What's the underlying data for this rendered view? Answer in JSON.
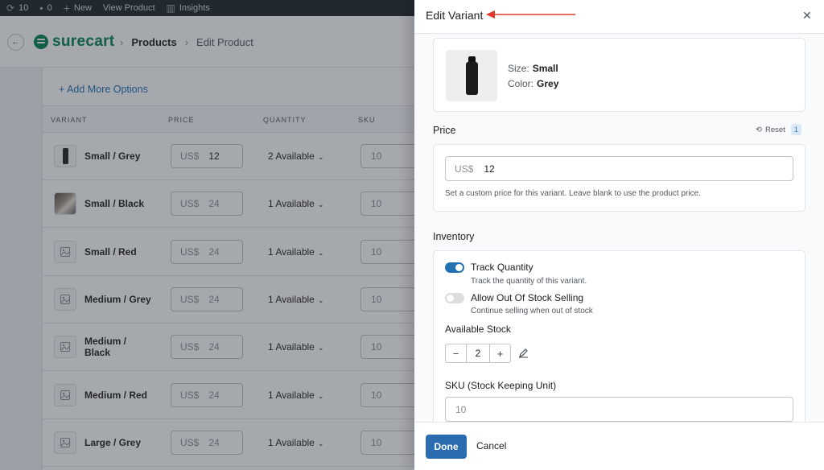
{
  "adminbar": {
    "updates": "10",
    "comments": "0",
    "new": "New",
    "view_product": "View Product",
    "insights": "Insights"
  },
  "header": {
    "logo": "surecart",
    "crumbs": [
      "Products",
      "Edit Product"
    ]
  },
  "variants_table": {
    "add_more": "+ Add More Options",
    "columns": [
      "VARIANT",
      "PRICE",
      "QUANTITY",
      "SKU"
    ],
    "currency": "US$",
    "rows": [
      {
        "name": "Small / Grey",
        "price": "12",
        "quantity": "2 Available",
        "sku": "10",
        "thumb": "bottle"
      },
      {
        "name": "Small / Black",
        "price": "24",
        "quantity": "1 Available",
        "sku": "10",
        "thumb": "photo"
      },
      {
        "name": "Small / Red",
        "price": "24",
        "quantity": "1 Available",
        "sku": "10",
        "thumb": "placeholder"
      },
      {
        "name": "Medium / Grey",
        "price": "24",
        "quantity": "1 Available",
        "sku": "10",
        "thumb": "placeholder"
      },
      {
        "name": "Medium / Black",
        "price": "24",
        "quantity": "1 Available",
        "sku": "10",
        "thumb": "placeholder"
      },
      {
        "name": "Medium / Red",
        "price": "24",
        "quantity": "1 Available",
        "sku": "10",
        "thumb": "placeholder"
      },
      {
        "name": "Large / Grey",
        "price": "24",
        "quantity": "1 Available",
        "sku": "10",
        "thumb": "placeholder"
      }
    ]
  },
  "drawer": {
    "title": "Edit Variant",
    "size_label": "Size:",
    "size_value": "Small",
    "color_label": "Color:",
    "color_value": "Grey",
    "price_title": "Price",
    "reset_label": "Reset",
    "reset_count": "1",
    "price_currency": "US$",
    "price_value": "12",
    "price_help": "Set a custom price for this variant. Leave blank to use the product price.",
    "inventory_title": "Inventory",
    "track_label": "Track Quantity",
    "track_desc": "Track the quantity of this variant.",
    "track_on": true,
    "oos_label": "Allow Out Of Stock Selling",
    "oos_desc": "Continue selling when out of stock",
    "oos_on": false,
    "stock_label": "Available Stock",
    "stock_minus": "−",
    "stock_value": "2",
    "stock_plus": "+",
    "sku_label": "SKU (Stock Keeping Unit)",
    "sku_value": "10",
    "done_label": "Done",
    "cancel_label": "Cancel",
    "close_glyph": "✕"
  },
  "colors": {
    "accent": "#2271b1",
    "brand": "#01824c",
    "annotation_arrow": "#e0392b",
    "done_button": "#2b6cb0"
  }
}
